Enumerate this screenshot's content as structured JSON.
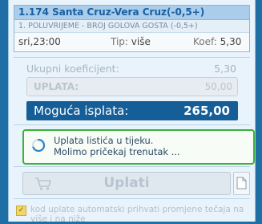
{
  "slip": {
    "title": "1.174 Santa Cruz-Vera Cruz(-0,5+)",
    "subtitle": "1. POLUVRIJEME - BROJ GOLOVA GOSTA (-0,5+)",
    "time": "sri,23:00",
    "tip_label": "Tip:",
    "tip_value": "više",
    "koef_label": "Koef:",
    "koef_value": "5,30"
  },
  "summary": {
    "ukupni_label": "Ukupni koeficijent:",
    "ukupni_value": "5,30",
    "uplata_label": "UPLATA:",
    "uplata_value": "50,00",
    "isplata_label": "Moguća isplata:",
    "isplata_value": "265,00"
  },
  "status": {
    "line1": "Uplata listića u tijeku.",
    "line2": "Molimo pričekaj trenutak ..."
  },
  "actions": {
    "uplati_label": "Uplati"
  },
  "auto_accept": {
    "checked": true,
    "check_mark": "✓",
    "label": "kod uplate automatski prihvati promjene tečaja na više i na niže"
  },
  "colors": {
    "header_bg": "#a9cdea",
    "title_text": "#1a5fa0",
    "isplata_bg": "#155e97",
    "status_border": "#38b23a"
  }
}
